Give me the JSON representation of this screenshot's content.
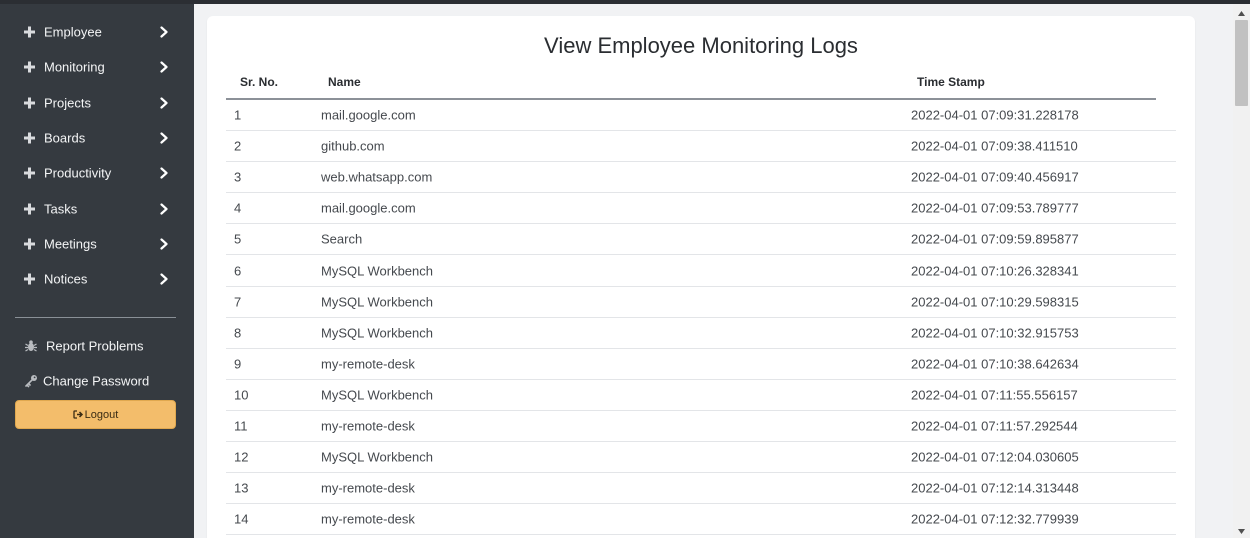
{
  "sidebar": {
    "nav_items": [
      {
        "label": "Employee"
      },
      {
        "label": "Monitoring"
      },
      {
        "label": "Projects"
      },
      {
        "label": "Boards"
      },
      {
        "label": "Productivity"
      },
      {
        "label": "Tasks"
      },
      {
        "label": "Meetings"
      },
      {
        "label": "Notices"
      }
    ],
    "report_label": "Report Problems",
    "change_password_label": "Change Password",
    "logout_label": "Logout"
  },
  "main": {
    "title": "View Employee Monitoring Logs",
    "columns": {
      "sr_no": "Sr. No.",
      "name": "Name",
      "time_stamp": "Time Stamp"
    },
    "rows": [
      {
        "sr": "1",
        "name": "mail.google.com",
        "ts": "2022-04-01 07:09:31.228178"
      },
      {
        "sr": "2",
        "name": "github.com",
        "ts": "2022-04-01 07:09:38.411510"
      },
      {
        "sr": "3",
        "name": "web.whatsapp.com",
        "ts": "2022-04-01 07:09:40.456917"
      },
      {
        "sr": "4",
        "name": "mail.google.com",
        "ts": "2022-04-01 07:09:53.789777"
      },
      {
        "sr": "5",
        "name": "Search",
        "ts": "2022-04-01 07:09:59.895877"
      },
      {
        "sr": "6",
        "name": "MySQL Workbench",
        "ts": "2022-04-01 07:10:26.328341"
      },
      {
        "sr": "7",
        "name": "MySQL Workbench",
        "ts": "2022-04-01 07:10:29.598315"
      },
      {
        "sr": "8",
        "name": "MySQL Workbench",
        "ts": "2022-04-01 07:10:32.915753"
      },
      {
        "sr": "9",
        "name": "my-remote-desk",
        "ts": "2022-04-01 07:10:38.642634"
      },
      {
        "sr": "10",
        "name": "MySQL Workbench",
        "ts": "2022-04-01 07:11:55.556157"
      },
      {
        "sr": "11",
        "name": "my-remote-desk",
        "ts": "2022-04-01 07:11:57.292544"
      },
      {
        "sr": "12",
        "name": "MySQL Workbench",
        "ts": "2022-04-01 07:12:04.030605"
      },
      {
        "sr": "13",
        "name": "my-remote-desk",
        "ts": "2022-04-01 07:12:14.313448"
      },
      {
        "sr": "14",
        "name": "my-remote-desk",
        "ts": "2022-04-01 07:12:32.779939"
      }
    ]
  },
  "colors": {
    "sidebar_bg": "#353a40",
    "logout_bg": "#f3bd6b",
    "page_bg": "#f1f2f4"
  }
}
